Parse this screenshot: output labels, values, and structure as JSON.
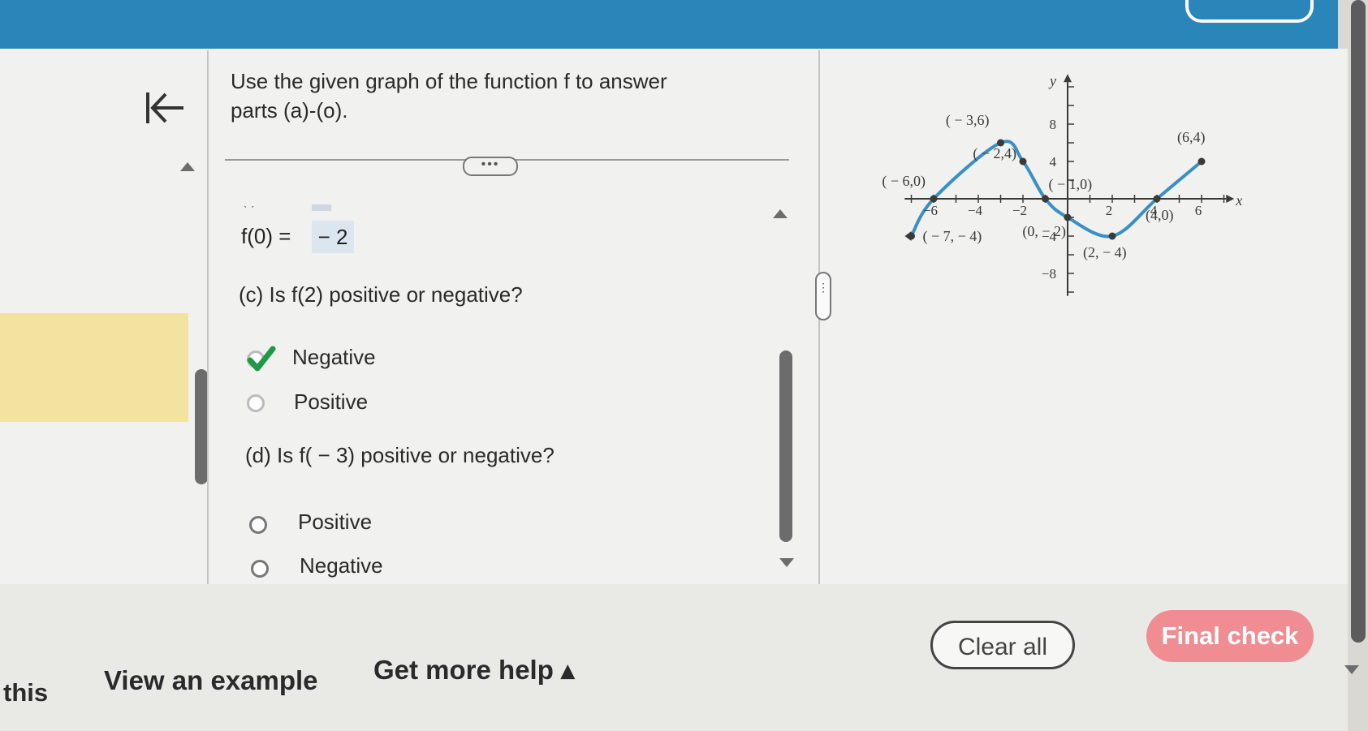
{
  "prompt": "Use the given graph of the function f to answer parts (a)-(o).",
  "more_button": "•••",
  "fragment_marks": "ˎ ˏ",
  "answer_a": {
    "label": "f(0)  =",
    "value": "− 2"
  },
  "question_c": {
    "text": "(c) Is f(2) positive or negative?",
    "options": [
      "Negative",
      "Positive"
    ],
    "selected": "Negative"
  },
  "question_d": {
    "text": "(d) Is f( − 3) positive or negative?",
    "options": [
      "Positive",
      "Negative"
    ]
  },
  "splitter": "⋮",
  "graph": {
    "x_axis_label": "x",
    "y_axis_label": "y",
    "x_ticks": [
      "−6",
      "−4",
      "−2",
      "2",
      "4",
      "6"
    ],
    "y_ticks": [
      "8",
      "4",
      "−4",
      "−8"
    ],
    "points": [
      {
        "x": -7,
        "y": -4,
        "label": "( − 7, − 4)"
      },
      {
        "x": -6,
        "y": 0,
        "label": "( − 6,0)"
      },
      {
        "x": -3,
        "y": 6,
        "label": "( − 3,6)"
      },
      {
        "x": -2,
        "y": 4,
        "label": "( − 2,4)"
      },
      {
        "x": -1,
        "y": 0,
        "label": "( − 1,0)"
      },
      {
        "x": 0,
        "y": -2,
        "label": "(0, − 2)"
      },
      {
        "x": 2,
        "y": -4,
        "label": "(2, − 4)"
      },
      {
        "x": 4,
        "y": 0,
        "label": "(4,0)"
      },
      {
        "x": 6,
        "y": 4,
        "label": "(6,4)"
      }
    ],
    "curve_color": "#3a8fc4"
  },
  "footer": {
    "this_label": "this",
    "view_example": "View an example",
    "get_more_help": "Get more help ▴",
    "clear_all": "Clear all",
    "final_check": "Final check"
  },
  "colors": {
    "top_bar": "#2a85b8",
    "final_check_bg": "#ef8d92",
    "answer_bg": "#dce6ee",
    "check": "#1e9a46"
  }
}
